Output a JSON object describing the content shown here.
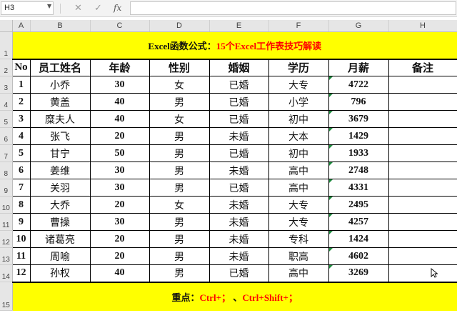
{
  "formula_bar": {
    "name_box": "H3",
    "cancel_glyph": "✕",
    "enter_glyph": "✓",
    "fx_glyph": "fx",
    "formula_value": ""
  },
  "columns": [
    "A",
    "B",
    "C",
    "D",
    "E",
    "F",
    "G",
    "H"
  ],
  "row_numbers": [
    "1",
    "2",
    "3",
    "4",
    "5",
    "6",
    "7",
    "8",
    "9",
    "10",
    "11",
    "12",
    "13",
    "14",
    "15"
  ],
  "title": {
    "prefix": "Excel函数公式：",
    "highlight": "15个Excel工作表技巧解读"
  },
  "table": {
    "headers": [
      "No",
      "员工姓名",
      "年龄",
      "性别",
      "婚姻",
      "学历",
      "月薪",
      "备注"
    ],
    "rows": [
      [
        "1",
        "小乔",
        "30",
        "女",
        "已婚",
        "大专",
        "4722",
        ""
      ],
      [
        "2",
        "黄盖",
        "40",
        "男",
        "已婚",
        "小学",
        "796",
        ""
      ],
      [
        "3",
        "糜夫人",
        "40",
        "女",
        "已婚",
        "初中",
        "3679",
        ""
      ],
      [
        "4",
        "张飞",
        "20",
        "男",
        "未婚",
        "大本",
        "1429",
        ""
      ],
      [
        "5",
        "甘宁",
        "50",
        "男",
        "已婚",
        "初中",
        "1933",
        ""
      ],
      [
        "6",
        "姜维",
        "30",
        "男",
        "未婚",
        "高中",
        "2748",
        ""
      ],
      [
        "7",
        "关羽",
        "30",
        "男",
        "已婚",
        "高中",
        "4331",
        ""
      ],
      [
        "8",
        "大乔",
        "20",
        "女",
        "未婚",
        "大专",
        "2495",
        ""
      ],
      [
        "9",
        "曹操",
        "30",
        "男",
        "未婚",
        "大专",
        "4257",
        ""
      ],
      [
        "10",
        "诸葛亮",
        "20",
        "男",
        "未婚",
        "专科",
        "1424",
        ""
      ],
      [
        "11",
        "周喻",
        "20",
        "男",
        "未婚",
        "职高",
        "4602",
        ""
      ],
      [
        "12",
        "孙权",
        "40",
        "男",
        "已婚",
        "高中",
        "3269",
        ""
      ]
    ]
  },
  "footer": {
    "label": "重点：",
    "part1": "Ctrl+；",
    "separator": " 、",
    "part2": "Ctrl+Shift+；"
  },
  "colors": {
    "highlight_fill": "#ffff00",
    "title_red": "#ff0000",
    "number_marker": "#1b8a3c"
  }
}
